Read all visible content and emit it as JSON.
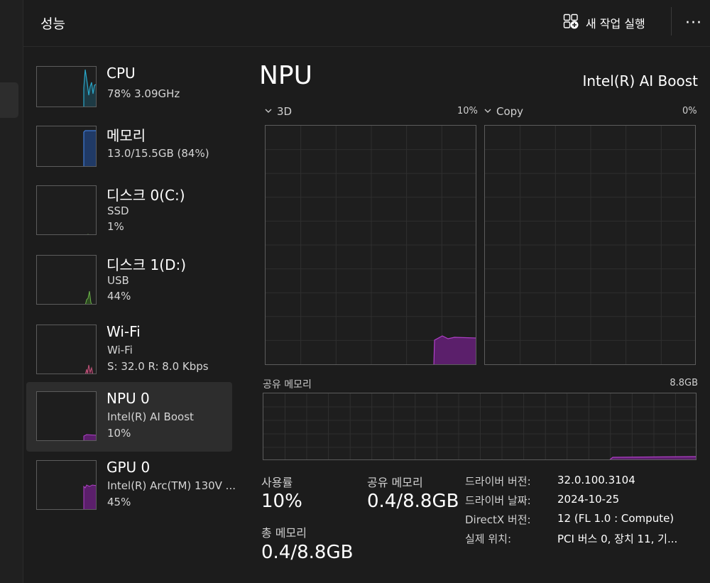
{
  "header": {
    "title": "성능",
    "new_task_label": "새 작업 실행",
    "more_label": "···"
  },
  "sidebar": {
    "items": [
      {
        "name": "CPU",
        "lines": [
          "78%  3.09GHz"
        ],
        "color": "#2aa7c9"
      },
      {
        "name": "메모리",
        "lines": [
          "13.0/15.5GB (84%)"
        ],
        "color": "#3f7ad6"
      },
      {
        "name": "디스크 0(C:)",
        "lines": [
          "SSD",
          "1%"
        ],
        "color": "#6bb34a"
      },
      {
        "name": "디스크 1(D:)",
        "lines": [
          "USB",
          "44%"
        ],
        "color": "#6bb34a"
      },
      {
        "name": "Wi-Fi",
        "lines": [
          "Wi-Fi",
          "S: 32.0  R: 8.0 Kbps"
        ],
        "color": "#c2547a"
      },
      {
        "name": "NPU 0",
        "lines": [
          "Intel(R) AI Boost",
          "10%"
        ],
        "color": "#9b2fae",
        "active": true
      },
      {
        "name": "GPU 0",
        "lines": [
          "Intel(R) Arc(TM) 130V ...",
          "45%"
        ],
        "color": "#9b2fae"
      }
    ]
  },
  "main": {
    "title": "NPU",
    "model": "Intel(R) AI Boost",
    "graph_3d": {
      "label": "3D",
      "percent": "10%"
    },
    "graph_copy": {
      "label": "Copy",
      "percent": "0%"
    },
    "shared_memory": {
      "label": "공유 메모리",
      "total": "8.8GB"
    },
    "stats": {
      "usage_label": "사용률",
      "usage_value": "10%",
      "shared_label": "공유 메모리",
      "shared_value": "0.4/8.8GB",
      "total_label": "총 메모리",
      "total_value": "0.4/8.8GB"
    },
    "info": [
      {
        "label": "드라이버 버전:",
        "value": "32.0.100.3104"
      },
      {
        "label": "드라이버 날짜:",
        "value": "2024-10-25"
      },
      {
        "label": "DirectX 버전:",
        "value": "12 (FL 1.0 : Compute)"
      },
      {
        "label": "실제 위치:",
        "value": "PCI 버스 0, 장치 11, 기..."
      }
    ]
  },
  "colors": {
    "npu_fill": "#5b1f6b",
    "npu_line": "#b040c8"
  }
}
